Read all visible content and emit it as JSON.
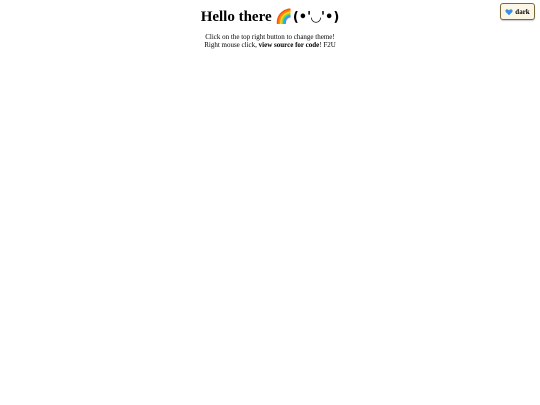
{
  "header": {
    "greeting": "Hello there",
    "emoji": "🌈",
    "face": "(•'◡'•)"
  },
  "instructions": {
    "line1": "Click on the top right button to change theme!",
    "line2_prefix": "Right mouse click, ",
    "line2_bold": "view source for code",
    "line2_suffix": "! F2U"
  },
  "theme_button": {
    "label": "dark",
    "icon": "blue-heart-icon",
    "icon_color": "#3a8ee6"
  }
}
